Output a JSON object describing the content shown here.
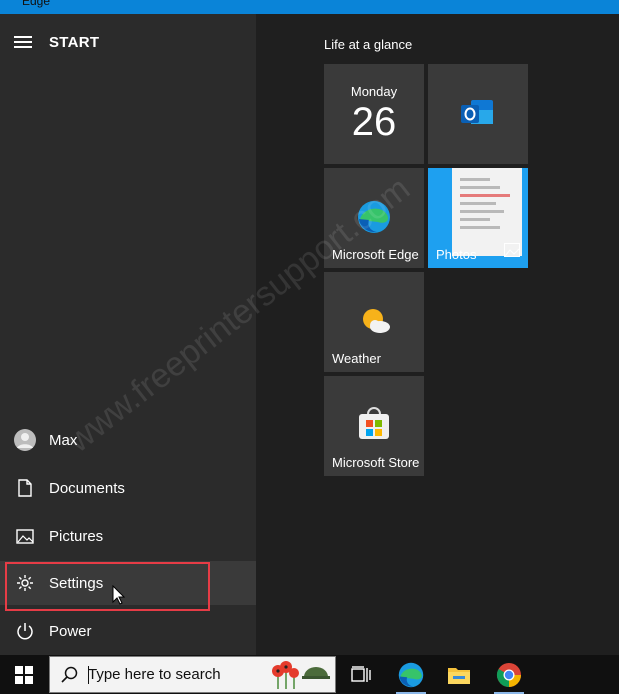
{
  "window": {
    "title_fragment": "Edge"
  },
  "start_menu": {
    "title": "START",
    "user": {
      "name": "Max"
    },
    "items": [
      {
        "label": "Documents",
        "icon": "document-icon"
      },
      {
        "label": "Pictures",
        "icon": "picture-icon"
      },
      {
        "label": "Settings",
        "icon": "gear-icon",
        "selected": true
      },
      {
        "label": "Power",
        "icon": "power-icon"
      }
    ]
  },
  "tiles": {
    "group_title": "Life at a glance",
    "calendar": {
      "day": "Monday",
      "date": "26"
    },
    "outlook": {
      "icon": "outlook-icon"
    },
    "edge": {
      "label": "Microsoft Edge",
      "icon": "edge-icon"
    },
    "photos": {
      "label": "Photos",
      "icon": "photos-icon"
    },
    "weather": {
      "label": "Weather",
      "icon": "weather-icon"
    },
    "store": {
      "label": "Microsoft Store",
      "icon": "store-icon"
    }
  },
  "taskbar": {
    "search_placeholder": "Type here to search",
    "icons": [
      "windows-icon",
      "search-icon",
      "task-view-icon",
      "edge-icon",
      "file-explorer-icon",
      "chrome-icon"
    ]
  },
  "watermark": "www.freeprintersupport.com",
  "colors": {
    "accent": "#0a84d8",
    "highlight": "#e63c46",
    "photos_tile": "#1ea0f0"
  }
}
